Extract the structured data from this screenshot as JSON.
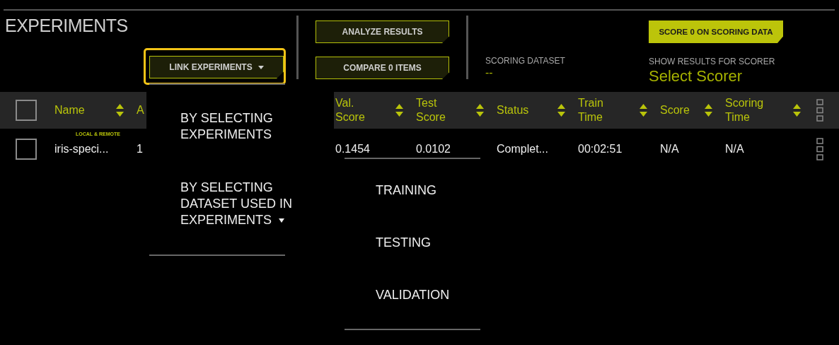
{
  "title": "EXPERIMENTS",
  "link_button": {
    "label": "LINK EXPERIMENTS",
    "focused": true
  },
  "actions": [
    {
      "label": "ANALYZE RESULTS"
    },
    {
      "label": "COMPARE 0 ITEMS"
    }
  ],
  "scoring_dataset": {
    "label": "SCORING DATASET",
    "value": "--"
  },
  "score_button": {
    "label": "SCORE 0 ON SCORING DATA"
  },
  "scorer": {
    "label": "SHOW RESULTS FOR SCORER",
    "value": "Select Scorer"
  },
  "table": {
    "all_checked": false,
    "columns": [
      {
        "label": "Name"
      },
      {
        "label": "A"
      },
      {
        "label": "Val. Score"
      },
      {
        "label": "Test Score"
      },
      {
        "label": "Status"
      },
      {
        "label": "Train Time"
      },
      {
        "label": "Score"
      },
      {
        "label": "Scoring Time"
      }
    ],
    "rows": [
      {
        "checked": false,
        "badge": "LOCAL & REMOTE",
        "cells": [
          "iris-speci...",
          "1",
          "0.1454",
          "0.0102",
          "Complet...",
          "00:02:51",
          "N/A",
          "N/A"
        ]
      }
    ]
  },
  "menu": {
    "items": [
      {
        "label": "BY SELECTING EXPERIMENTS",
        "has_submenu": false
      },
      {
        "label": "BY SELECTING DATASET USED IN EXPERIMENTS",
        "has_submenu": true
      }
    ]
  },
  "submenu": {
    "items": [
      {
        "label": "TRAINING"
      },
      {
        "label": "TESTING"
      },
      {
        "label": "VALIDATION"
      }
    ]
  }
}
